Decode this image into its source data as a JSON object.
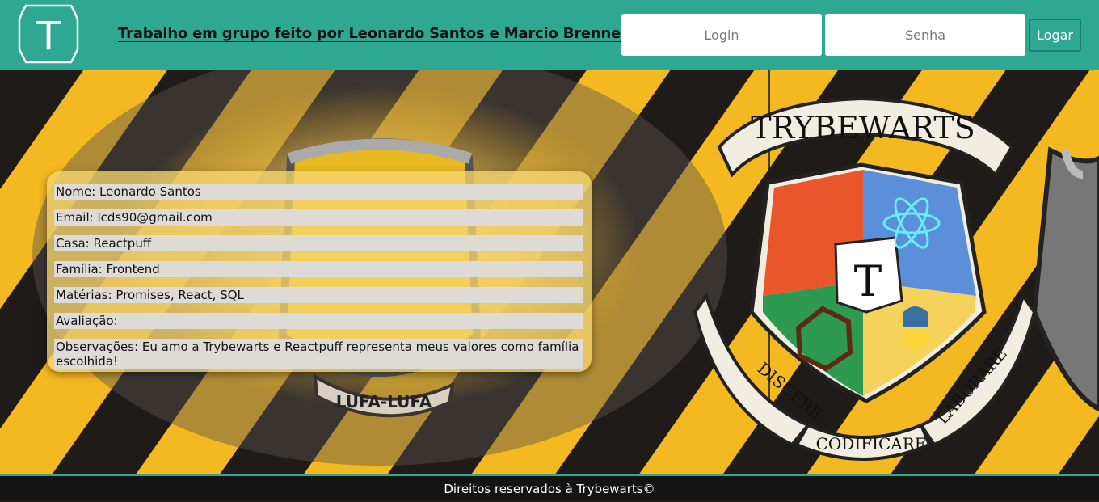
{
  "header": {
    "title": "Trabalho em grupo feito por Leonardo Santos e Marcio Brenner",
    "logo_letter": "T",
    "login_placeholder": "Login",
    "senha_placeholder": "Senha",
    "logar_label": "Logar"
  },
  "crest": {
    "banner_text": "TRYBEWARTS",
    "center_letter": "T",
    "motto": [
      "DISCERE",
      "CODIFICARE",
      "LABORARE"
    ]
  },
  "badge": {
    "text": "LUFA-LUFA"
  },
  "form_data": {
    "rows": [
      "Nome: Leonardo Santos",
      "Email: lcds90@gmail.com",
      "Casa: Reactpuff",
      "Família: Frontend",
      "Matérias: Promises, React, SQL",
      "Avaliação:",
      "Observações: Eu amo a Trybewarts e Reactpuff representa meus valores como família escolhida!"
    ]
  },
  "footer": {
    "text": "Direitos reservados à Trybewarts©"
  },
  "colors": {
    "header_bg": "#2fa893",
    "stripe_yellow": "#f4b820",
    "stripe_dark": "#1f1b18",
    "footer_bg": "#141414"
  }
}
